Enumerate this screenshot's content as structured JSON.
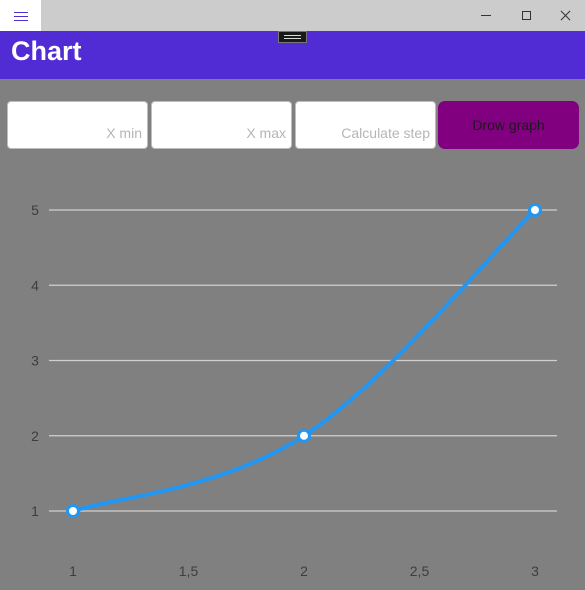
{
  "window": {
    "title_bar": {
      "menu_icon": "hamburger-icon",
      "minimize_icon": "minimize-icon",
      "maximize_icon": "maximize-icon",
      "close_icon": "close-icon"
    }
  },
  "header": {
    "title": "Chart",
    "background": "#512bd4"
  },
  "inputs": {
    "x_min": {
      "placeholder": "X min",
      "value": ""
    },
    "x_max": {
      "placeholder": "X max",
      "value": ""
    },
    "step": {
      "placeholder": "Calculate step",
      "value": ""
    }
  },
  "draw_button": {
    "label": "Drow graph",
    "color": "#800080"
  },
  "chart_data": {
    "type": "line",
    "x": [
      1,
      2,
      3
    ],
    "y": [
      1,
      2,
      5
    ],
    "xticks": [
      "1",
      "1,5",
      "2",
      "2,5",
      "3"
    ],
    "xtick_values": [
      1,
      1.5,
      2,
      2.5,
      3
    ],
    "yticks": [
      "1",
      "2",
      "3",
      "4",
      "5"
    ],
    "ytick_values": [
      1,
      2,
      3,
      4,
      5
    ],
    "xlim": [
      1,
      3
    ],
    "ylim": [
      1,
      5
    ],
    "grid": "horizontal",
    "line_color": "#2196f3",
    "smooth": true,
    "title": "",
    "xlabel": "",
    "ylabel": ""
  }
}
